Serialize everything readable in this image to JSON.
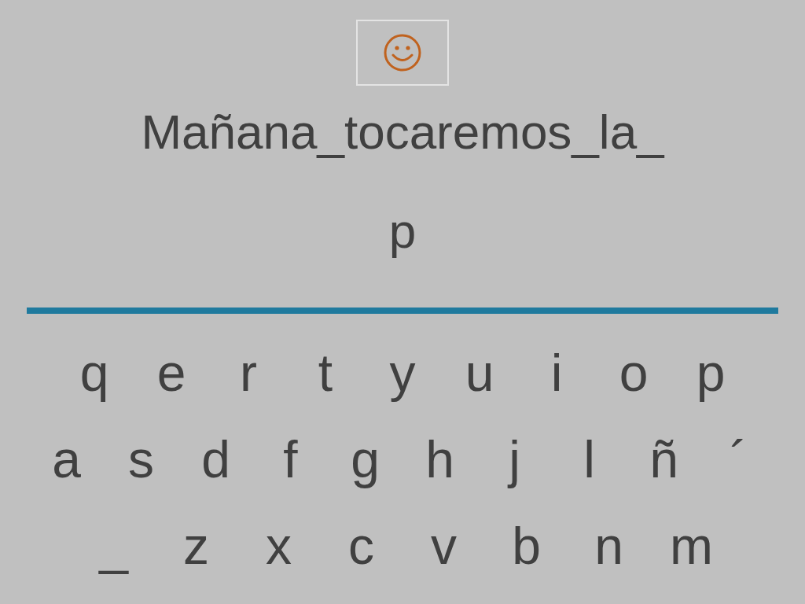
{
  "sentence": "Mañana_tocaremos_la_",
  "answer": "p",
  "keyboard": {
    "rows": [
      [
        "q",
        "e",
        "r",
        "t",
        "y",
        "u",
        "i",
        "o",
        "p"
      ],
      [
        "a",
        "s",
        "d",
        "f",
        "g",
        "h",
        "j",
        "l",
        "ñ",
        "´"
      ],
      [
        "_",
        "z",
        "x",
        "c",
        "v",
        "b",
        "n",
        "m"
      ]
    ]
  }
}
